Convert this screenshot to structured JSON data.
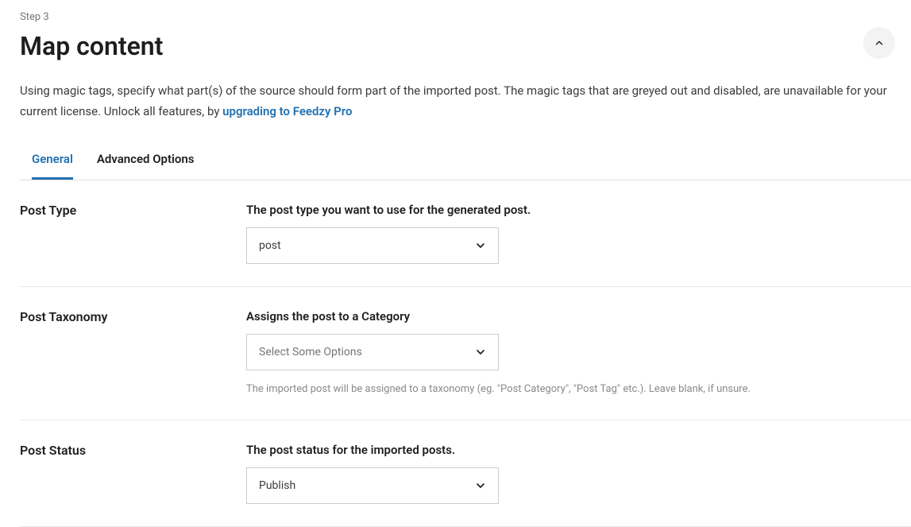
{
  "step_label": "Step 3",
  "page_title": "Map content",
  "intro_text_a": "Using magic tags, specify what part(s) of the source should form part of the imported post. The magic tags that are greyed out and disabled, are unavailable for your current license. Unlock all features, by ",
  "intro_link": "upgrading to Feedzy Pro",
  "tabs": {
    "general": "General",
    "advanced": "Advanced Options"
  },
  "fields": {
    "post_type": {
      "label": "Post Type",
      "desc": "The post type you want to use for the generated post.",
      "value": "post"
    },
    "post_taxonomy": {
      "label": "Post Taxonomy",
      "desc": "Assigns the post to a Category",
      "placeholder": "Select Some Options",
      "help": "The imported post will be assigned to a taxonomy (eg. \"Post Category\", \"Post Tag\" etc.). Leave blank, if unsure."
    },
    "post_status": {
      "label": "Post Status",
      "desc": "The post status for the imported posts.",
      "value": "Publish"
    }
  }
}
